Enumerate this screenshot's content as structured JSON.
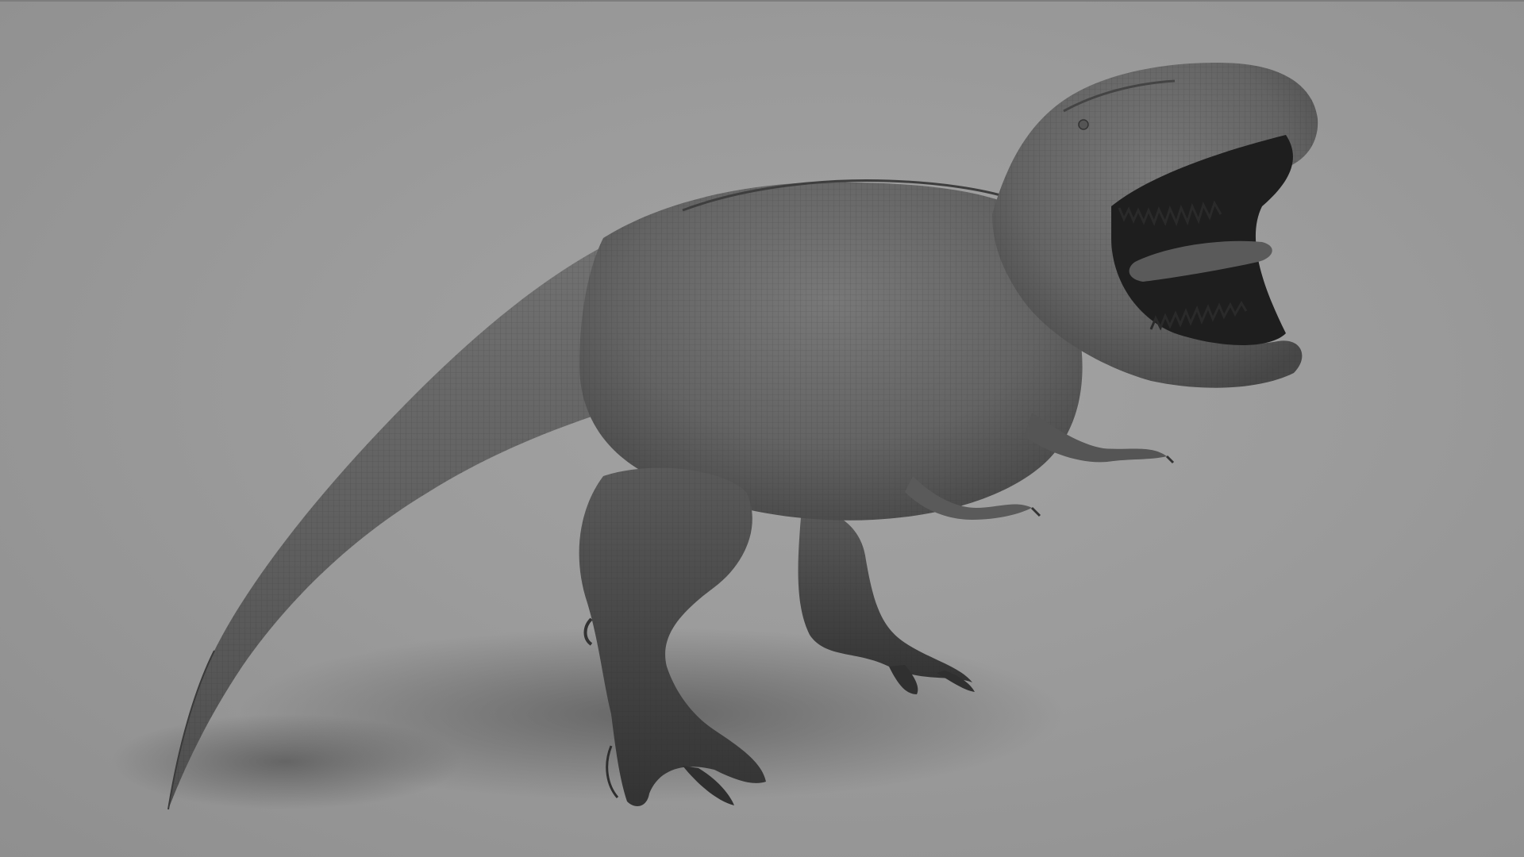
{
  "scene": {
    "subject": "t-rex-wireframe-model",
    "colors": {
      "background": "#9b9b9b",
      "skin_light": "#6f6f6f",
      "skin_mid": "#5a5a5a",
      "skin_dark": "#3c3c3c",
      "mouth_interior": "#1e1e1e",
      "tongue": "#5a5a5a",
      "teeth": "#2a2a2a",
      "shadow": "#5f5f5f"
    }
  }
}
